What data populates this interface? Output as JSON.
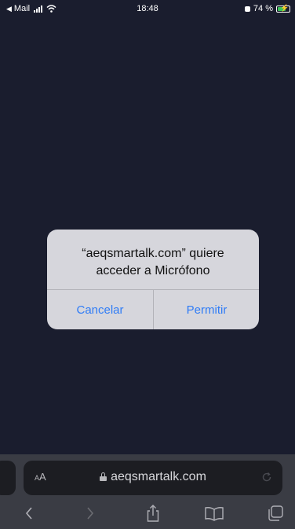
{
  "status_bar": {
    "back_app": "Mail",
    "time": "18:48",
    "battery_percent": "74 %",
    "battery_level": 0.74,
    "battery_color": "#3ac15a"
  },
  "dialog": {
    "title": "“aeqsmartalk.com” quiere acceder a Micrófono",
    "cancel_label": "Cancelar",
    "allow_label": "Permitir",
    "button_color": "#2f7cf6"
  },
  "address_bar": {
    "text_size_label": "AA",
    "url": "aeqsmartalk.com",
    "lock_icon": "lock-icon",
    "reload_icon": "reload-icon"
  },
  "toolbar": {
    "items": [
      {
        "icon": "back-icon"
      },
      {
        "icon": "forward-icon"
      },
      {
        "icon": "share-icon"
      },
      {
        "icon": "bookmarks-icon"
      },
      {
        "icon": "tabs-icon"
      }
    ]
  },
  "colors": {
    "background": "#1a1d2e",
    "bar": "#3a3c44",
    "field": "#1c1d22"
  }
}
